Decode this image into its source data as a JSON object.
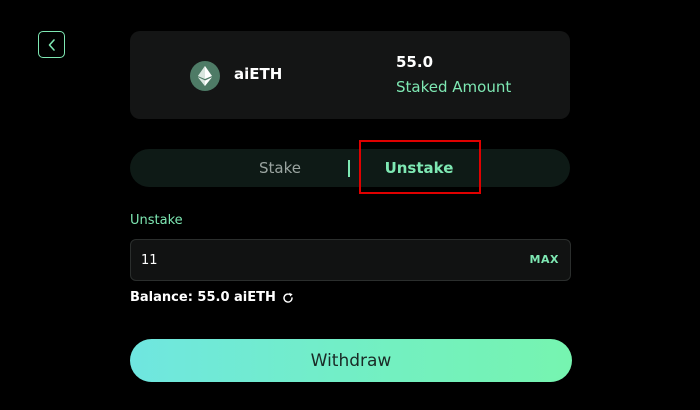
{
  "header": {
    "back_icon": "chevron-left-icon"
  },
  "token": {
    "icon": "ethereum-icon",
    "name": "aiETH",
    "staked_value": "55.0",
    "staked_label": "Staked Amount"
  },
  "tabs": {
    "stake_label": "Stake",
    "unstake_label": "Unstake",
    "active": "Unstake"
  },
  "form": {
    "label": "Unstake",
    "amount_value": "11",
    "max_label": "MAX",
    "balance_text": "Balance: 55.0 aiETH",
    "refresh_icon": "refresh-icon"
  },
  "action": {
    "withdraw_label": "Withdraw"
  },
  "colors": {
    "accent": "#7ee8b3",
    "background": "#000000",
    "card": "#141515",
    "highlight": "#e00000"
  }
}
